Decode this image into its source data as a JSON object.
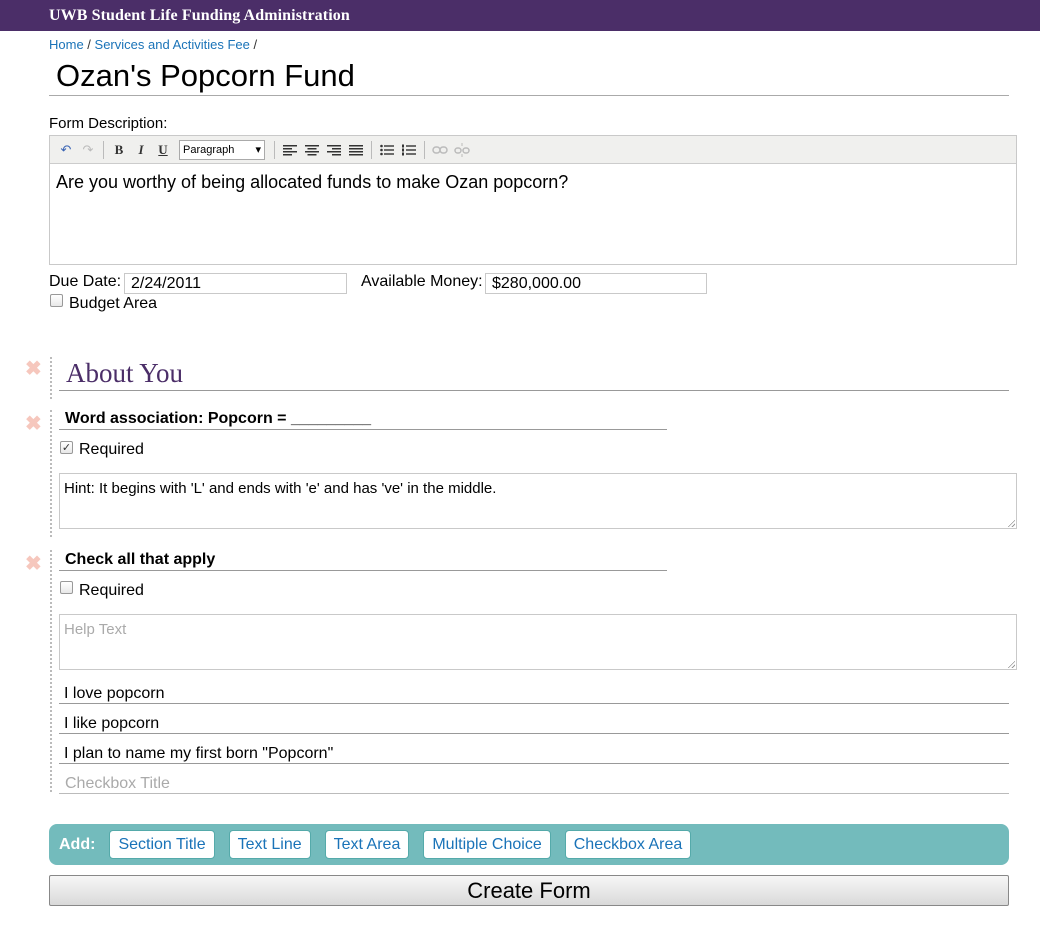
{
  "app": {
    "title": "UWB Student Life Funding Administration"
  },
  "breadcrumb": {
    "home": "Home",
    "sep1": " / ",
    "section": "Services and Activities Fee",
    "sep2": " /"
  },
  "form": {
    "title": "Ozan's Popcorn Fund",
    "description_label": "Form Description:",
    "format_select": "Paragraph",
    "description_text": "Are you worthy of being allocated funds to make Ozan popcorn?",
    "due_date_label": "Due Date:",
    "due_date_value": "2/24/2011",
    "money_label": "Available Money:",
    "money_value": "$280,000.00",
    "budget_area_label": "Budget Area"
  },
  "sections": {
    "about": {
      "title": "About You"
    },
    "q1": {
      "title": "Word association: Popcorn = _________",
      "required_label": "Required",
      "required_checked": true,
      "help_text": "Hint: It begins with 'L' and ends with 'e' and has 've' in the middle."
    },
    "q2": {
      "title": "Check all that apply",
      "required_label": "Required",
      "required_checked": false,
      "help_placeholder": "Help Text",
      "options": [
        "I love popcorn",
        "I like popcorn",
        "I plan to name my first born \"Popcorn\""
      ],
      "new_option_placeholder": "Checkbox Title"
    }
  },
  "add_bar": {
    "label": "Add:",
    "buttons": [
      "Section Title",
      "Text Line",
      "Text Area",
      "Multiple Choice",
      "Checkbox Area"
    ]
  },
  "create_button": "Create Form",
  "icons": {
    "check": "✓",
    "delete": "✖",
    "dropdown": "▾"
  },
  "colors": {
    "header": "#4b2e68",
    "add_bar": "#73bbbc",
    "link": "#1a73b8"
  }
}
